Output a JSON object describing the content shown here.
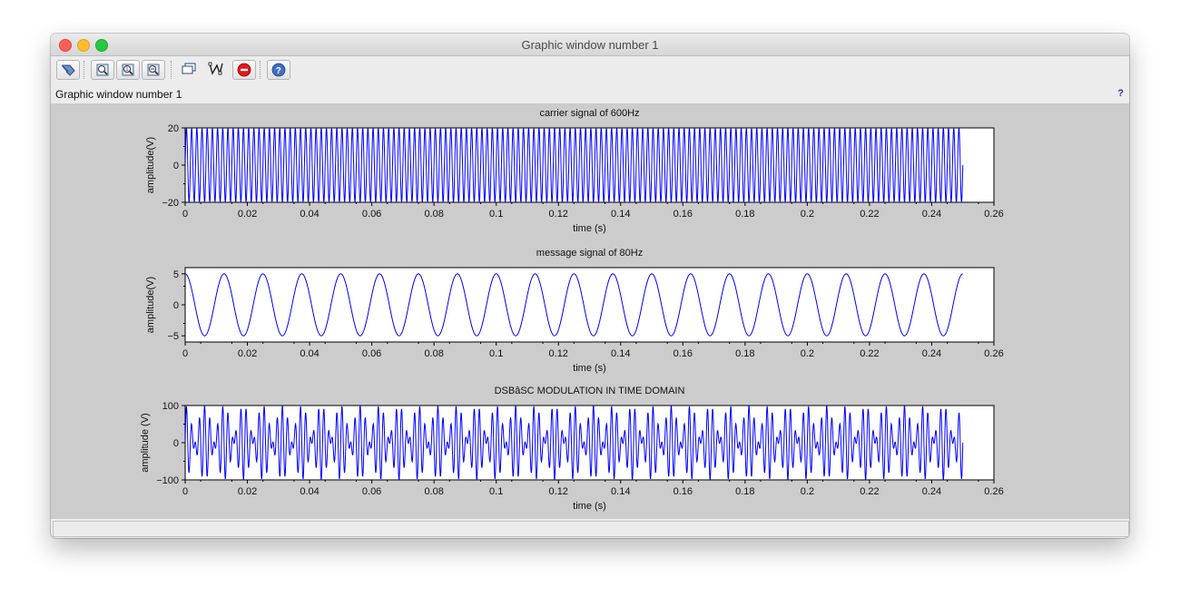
{
  "window": {
    "title": "Graphic window number 1"
  },
  "infobar": {
    "text": "Graphic window number 1",
    "help": "?"
  },
  "toolbar": {
    "buttons": [
      {
        "icon": "rotate-icon"
      },
      {
        "icon": "zoom-in-icon"
      },
      {
        "icon": "zoom-original-icon"
      },
      {
        "icon": "zoom-area-icon"
      },
      {
        "icon": "datatip-icon"
      },
      {
        "icon": "datatip-mode-icon"
      },
      {
        "icon": "stop-icon"
      },
      {
        "icon": "help-icon"
      }
    ]
  },
  "colors": {
    "line": "#0000ff",
    "plot_bg": "#ffffff",
    "figure_bg": "#cccccc",
    "stop": "#e0181b"
  },
  "chart_data": [
    {
      "type": "line",
      "title": "carrier signal of 600Hz",
      "xlabel": "time (s)",
      "ylabel": "amplitude(V)",
      "xlim": [
        0,
        0.26
      ],
      "ylim": [
        -20,
        20
      ],
      "xticks": [
        "0",
        "0.02",
        "0.04",
        "0.06",
        "0.08",
        "0.1",
        "0.12",
        "0.14",
        "0.16",
        "0.18",
        "0.2",
        "0.22",
        "0.24",
        "0.26"
      ],
      "yticks": [
        "20",
        "0",
        "−20"
      ],
      "grid": false,
      "series": [
        {
          "function": "20*sin(2*pi*600*t)",
          "t_range": [
            0,
            0.25
          ],
          "dt": 0.0001
        }
      ]
    },
    {
      "type": "line",
      "title": "message signal of 80Hz",
      "xlabel": "time (s)",
      "ylabel": "amplitude(V)",
      "xlim": [
        0,
        0.26
      ],
      "ylim": [
        -6,
        6
      ],
      "xticks": [
        "0",
        "0.02",
        "0.04",
        "0.06",
        "0.08",
        "0.1",
        "0.12",
        "0.14",
        "0.16",
        "0.18",
        "0.2",
        "0.22",
        "0.24",
        "0.26"
      ],
      "yticks": [
        "5",
        "0",
        "−5"
      ],
      "grid": false,
      "series": [
        {
          "function": "5*cos(2*pi*80*t)",
          "t_range": [
            0,
            0.25
          ],
          "dt": 0.0001
        }
      ]
    },
    {
      "type": "line",
      "title": "DSBâSC MODULATION IN TIME DOMAIN",
      "xlabel": "time (s)",
      "ylabel": "amplitude (V)",
      "xlim": [
        0,
        0.26
      ],
      "ylim": [
        -100,
        100
      ],
      "xticks": [
        "0",
        "0.02",
        "0.04",
        "0.06",
        "0.08",
        "0.1",
        "0.12",
        "0.14",
        "0.16",
        "0.18",
        "0.2",
        "0.22",
        "0.24",
        "0.26"
      ],
      "yticks": [
        "100",
        "0",
        "−100"
      ],
      "grid": false,
      "series": [
        {
          "function": "100*sin(2*pi*600*t)*cos(2*pi*80*t)",
          "t_range": [
            0,
            0.25
          ],
          "dt": 0.0001
        }
      ]
    }
  ]
}
